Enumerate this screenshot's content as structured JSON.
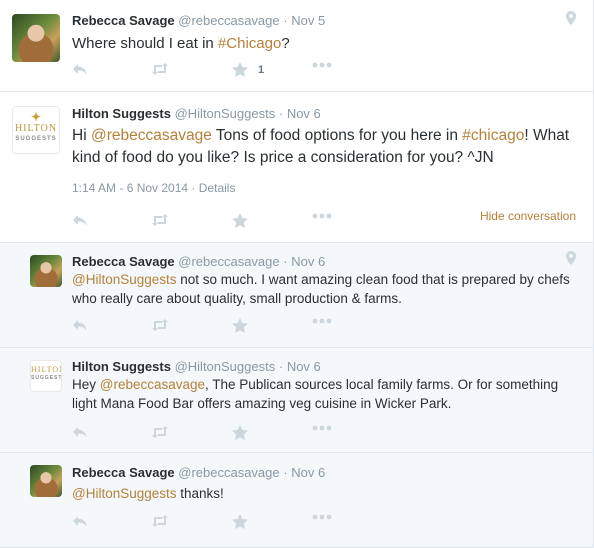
{
  "tweets": [
    {
      "name": "Rebecca Savage",
      "handle": "@rebeccasavage",
      "sep": "·",
      "time": "Nov 5",
      "text_plain": "Where should I eat in ",
      "hashtag": "#Chicago",
      "text_end": "?",
      "favorite_count": "1"
    },
    {
      "name": "Hilton Suggests",
      "handle": "@HiltonSuggests",
      "sep": "·",
      "time": "Nov 6",
      "text_a": "Hi ",
      "mention": "@rebeccasavage",
      "text_b": " Tons of food options for you here in ",
      "hashtag": "#chicago",
      "text_c": "! What kind of food do you like?  Is price a consideration for you?  ^JN",
      "timestamp": "1:14 AM - 6 Nov 2014",
      "details_label": "Details",
      "hide_label": "Hide conversation"
    },
    {
      "name": "Rebecca Savage",
      "handle": "@rebeccasavage",
      "sep": "·",
      "time": "Nov 6",
      "mention": "@HiltonSuggests",
      "text": " not so much. I want amazing clean food that is prepared by chefs who really care about quality, small production & farms."
    },
    {
      "name": "Hilton Suggests",
      "handle": "@HiltonSuggests",
      "sep": "·",
      "time": "Nov 6",
      "text_a": "Hey ",
      "mention": "@rebeccasavage",
      "text_b": ", The Publican sources local family farms. Or for something light Mana Food Bar offers amazing veg cuisine in Wicker Park."
    },
    {
      "name": "Rebecca Savage",
      "handle": "@rebeccasavage",
      "sep": "·",
      "time": "Nov 6",
      "mention": "@HiltonSuggests",
      "text": " thanks!"
    }
  ],
  "hilton_logo": {
    "word": "HILTON",
    "sub": "SUGGESTS",
    "mark": "✦"
  },
  "colors": {
    "link": "#b5813a",
    "muted": "#8899a6",
    "icon": "#ccd6dd",
    "reply_bg": "#f5f8fa"
  },
  "icons": [
    "reply-icon",
    "retweet-icon",
    "favorite-icon",
    "more-icon",
    "geo-pin-icon"
  ]
}
